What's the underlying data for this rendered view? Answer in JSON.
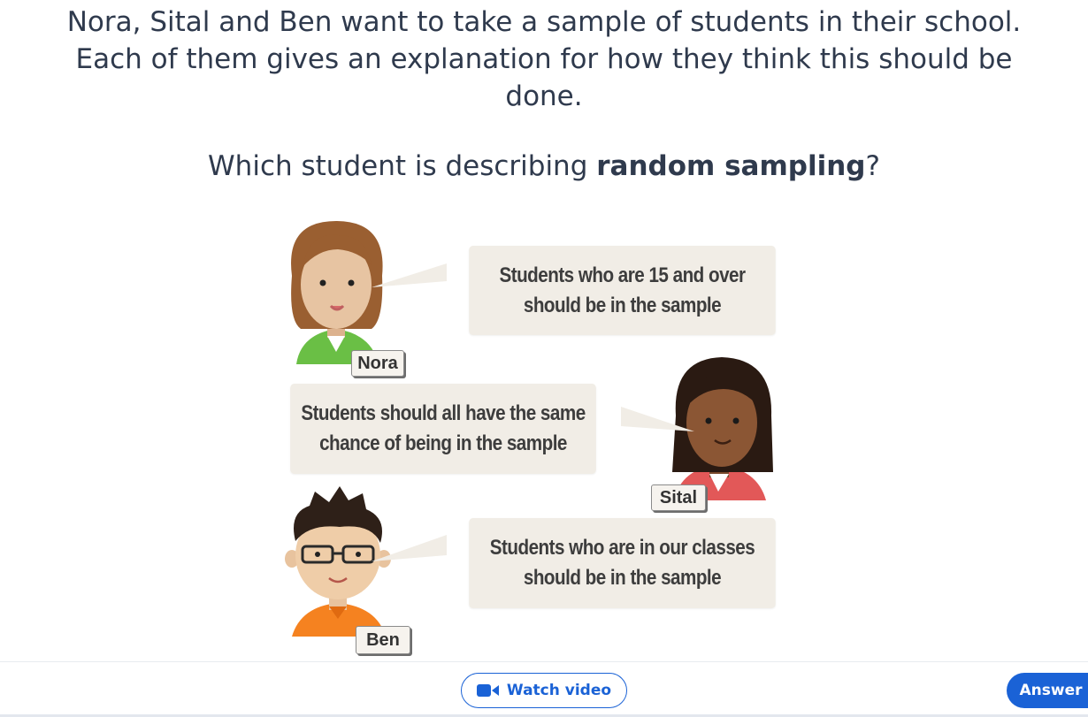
{
  "question": {
    "line1": "Nora, Sital and Ben want to take a sample of students in their school.",
    "line2": "Each of them gives an explanation for how they think this should be",
    "line3": "done.",
    "prompt_before": "Which student is describing ",
    "prompt_bold": "random sampling",
    "prompt_after": "?"
  },
  "students": [
    {
      "name": "Nora",
      "line1": "Students who are 15 and over",
      "line2": "should be in the sample"
    },
    {
      "name": "Sital",
      "line1": "Students should all have the same",
      "line2": "chance of being in the sample"
    },
    {
      "name": "Ben",
      "line1": "Students who are in our classes",
      "line2": "should be in the sample"
    }
  ],
  "footer": {
    "watch_video_label": "Watch video",
    "answer_label": "Answer",
    "video_icon": "video-camera-icon"
  },
  "colors": {
    "text": "#2f3a4d",
    "accent": "#1a62d6",
    "bubble": "#f1ede6"
  }
}
